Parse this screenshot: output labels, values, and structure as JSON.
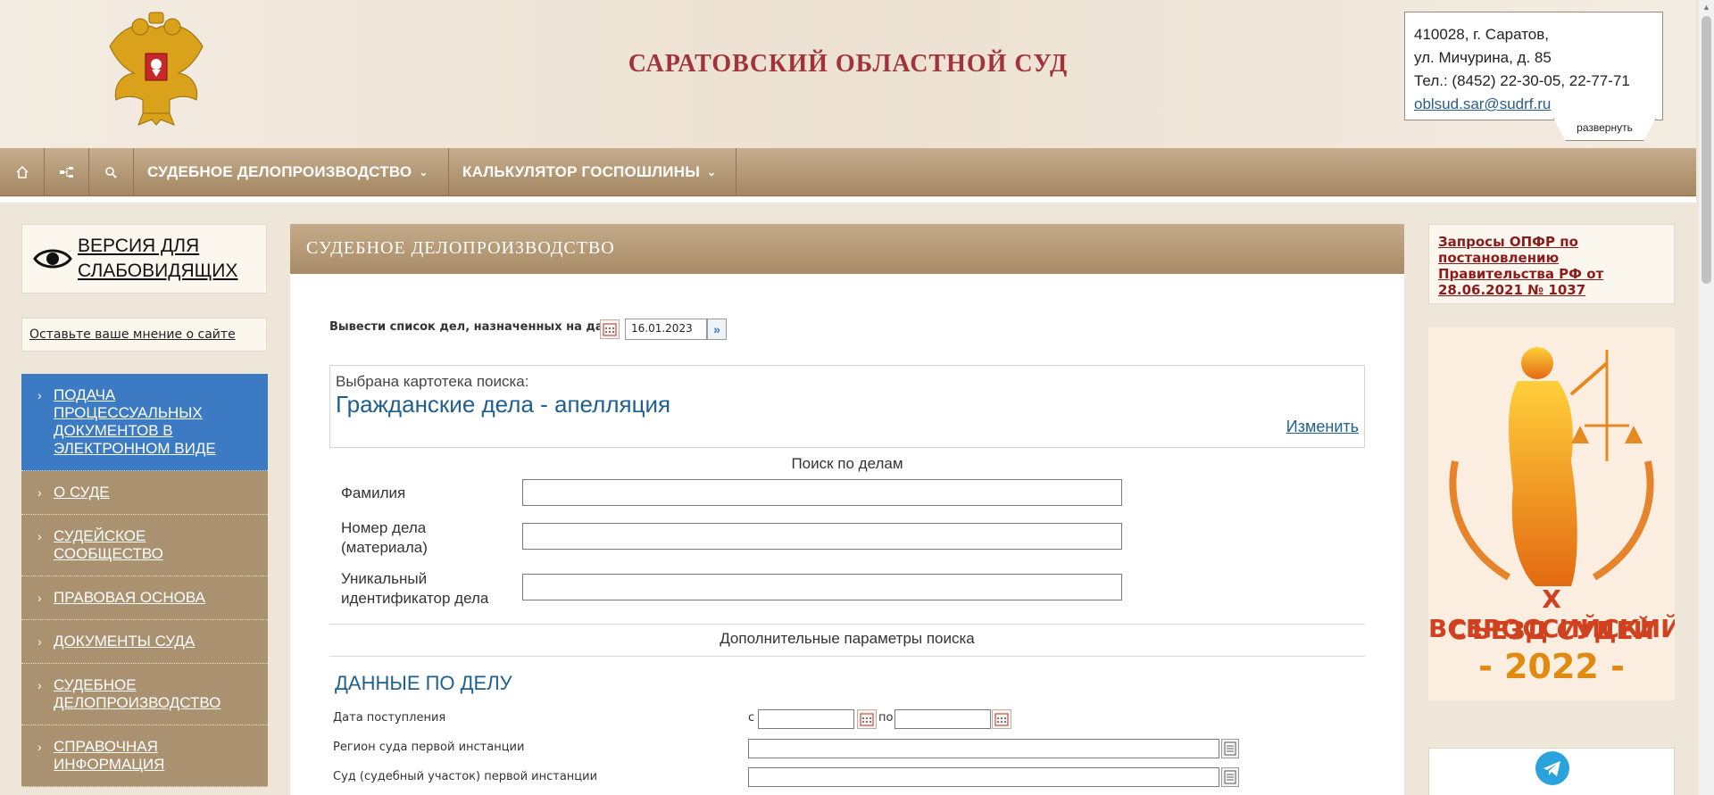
{
  "header": {
    "title": "САРАТОВСКИЙ ОБЛАСТНОЙ СУД",
    "address_line1": "410028, г. Саратов,",
    "address_line2": "ул. Мичурина, д. 85",
    "phone": "Тел.: (8452) 22-30-05, 22-77-71",
    "email": "oblsud.sar@sudrf.ru",
    "expand_label": "развернуть"
  },
  "nav": {
    "home_icon": "home-icon",
    "sitemap_icon": "sitemap-icon",
    "search_icon": "search-icon",
    "items": [
      {
        "label": "СУДЕБНОЕ ДЕЛОПРОИЗВОДСТВО"
      },
      {
        "label": "КАЛЬКУЛЯТОР ГОСПОШЛИНЫ"
      }
    ]
  },
  "sidebar": {
    "vision_label_1": "ВЕРСИЯ ДЛЯ",
    "vision_label_2": "СЛАБОВИДЯЩИХ",
    "feedback": "Оставьте ваше мнение о сайте",
    "menu": [
      {
        "label": "Подача процессуальных документов в электронном виде",
        "active": true
      },
      {
        "label": "О суде",
        "active": false
      },
      {
        "label": "Судейское сообщество",
        "active": false
      },
      {
        "label": "Правовая основа",
        "active": false
      },
      {
        "label": "Документы суда",
        "active": false
      },
      {
        "label": "Судебное делопроизводство",
        "active": false
      },
      {
        "label": "Справочная информация",
        "active": false
      }
    ]
  },
  "main": {
    "heading": "СУДЕБНОЕ ДЕЛОПРОИЗВОДСТВО",
    "date_label": "Вывести список дел, назначенных на дату",
    "date_value": "16.01.2023",
    "card_label": "Выбрана картотека поиска:",
    "card_value": "Гражданские дела - апелляция",
    "change_label": "Изменить",
    "search_title": "Поиск по делам",
    "fields": {
      "surname": "Фамилия",
      "case_number_1": "Номер дела",
      "case_number_2": "(материала)",
      "uid_1": "Уникальный",
      "uid_2": "идентификатор дела"
    },
    "extra_title": "Дополнительные параметры поиска",
    "section_title": "ДАННЫЕ ПО ДЕЛУ",
    "receipt_label": "Дата поступления",
    "from_label": "с",
    "to_label": "по",
    "region_label": "Регион суда первой инстанции",
    "court_label": "Суд (судебный участок) первой инстанции"
  },
  "right": {
    "notice": "Запросы ОПФР по постановлению Правительства РФ от 28.06.2021 № 1037",
    "banner_line1": "X ВСЕРОССИЙСКИЙ",
    "banner_line2": "СЪЕЗД СУДЕЙ",
    "banner_year": "- 2022 -"
  },
  "colors": {
    "title_red": "#a0343a",
    "nav_brown": "#a88b66",
    "active_blue": "#3c7bc3",
    "link_blue": "#1f5f8f"
  }
}
